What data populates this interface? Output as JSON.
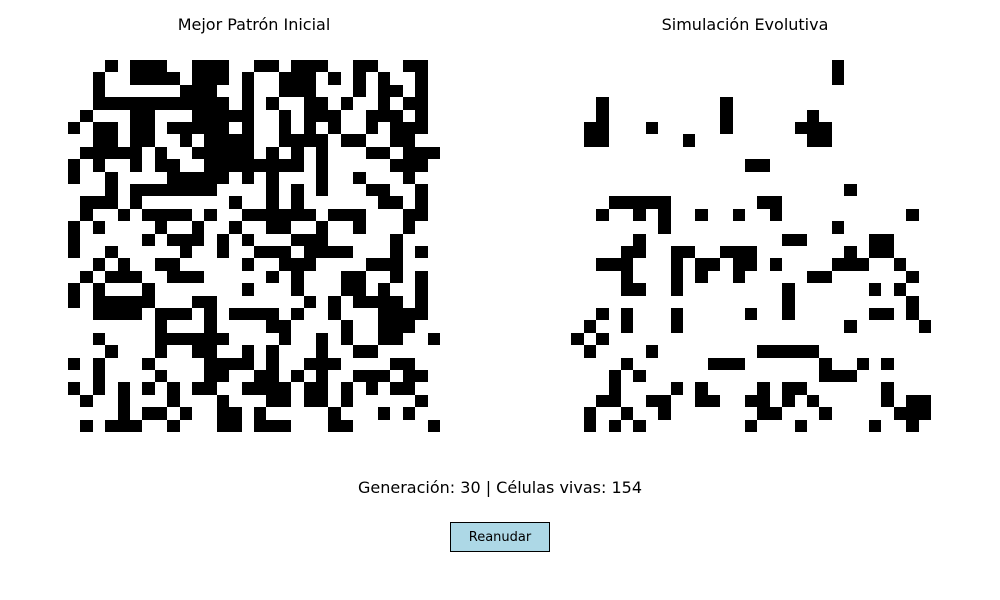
{
  "left_panel": {
    "title": "Mejor Patrón Inicial"
  },
  "right_panel": {
    "title": "Simulación Evolutiva"
  },
  "status": {
    "text": "Generación: 30 | Células vivas: 154",
    "generation": 30,
    "live_cells": 154
  },
  "controls": {
    "resume_label": "Reanudar"
  },
  "colors": {
    "alive": "#000000",
    "dead": "#ffffff",
    "button_bg": "#add8e6"
  },
  "grids": {
    "size": 30,
    "initial": [
      "...x.xxx..xxx..xx.xxx..xx..xx.",
      "..x..xxxx.xxx.x..xxx.x.x.x..x.",
      "..x......xxx..x..xxx...x.xx.x.",
      "..xxxxxxxxxxx.x.x..xx.x..x.xx.",
      ".x...xx...xxxxx..x.xxx..xxx.x.",
      "x.xx.xx.xxxxx.x..x.x.x..x.xxx.",
      "..xx.xx..x.xxxx..xxxx.xx..xx..",
      ".xxxxx.x..xxxxx.x.x.x...xx.xxx",
      "x.x..x.xx..xxxxxxxx.x.....xxx.",
      "x..x....xxxxx.x.x...x..x...x..",
      "...x.xxxxxxx....x.x.x...xx..x.",
      ".xxx.x.......x..x.x......xx.x.",
      ".x..x.xxxx.x..xxxxxx.xxx...xx.",
      "x.x....x..x..x..xx..x..x...x..",
      "x.....x.xxx.x.x...xxx.....x...",
      "x..x.....x..x..xxx.xxxx...x.x.",
      "..x.x..xx.....x..xxx....xxx...",
      ".x.xxx..xxx.....x.x...xx..x.x.",
      "x.x...x.......x...x...xx.x..x.",
      "x.xxxxx...xx.......x.x.xxxx.x.",
      "..xxxx.xxx.x.xxxx.x..x...xxxx.",
      ".......x...x....xx....x..xxx..",
      "..x....xxxxxx....x..x.x..xx..x",
      "...x...x..xx..x.x...x..xx.....",
      "x.x...x....xxxx.x..xxx....xx..",
      "..x....x...xx..xx.x.x..xxx.xx.",
      "x.x.x.x.x.xx..xxxx.xx.x.x.xx..",
      ".x..x...x...x...xx.xx.x.....x.",
      "....x.xx.x..xx.x.....x...x.x..",
      ".x.xxx..x...xx.xxx...xx......x"
    ],
    "current": [
      "......................x.......",
      "......................x.......",
      "..............................",
      "...x.........x................",
      "...x.........x......x.........",
      "..xx...x.....x.....xxx........",
      "..xx......x.........xx........",
      "..............................",
      "...............xx.............",
      "..............................",
      ".......................x......",
      "....xxxxx.......xx............",
      "...x..x.x..x..x..x..........x.",
      "........x.............x.......",
      "......x...........xx.....xx...",
      ".....xx..xx..xxx.......x.xx...",
      "...xxx...x.xx.xx.x....xxx..x..",
      ".....x...x.x..x.....xx......x.",
      ".....xx..x........x......x.x..",
      "..................x.........x.",
      "...x.x...x.....x..x......xx.x.",
      "..x..x...x.............x.....x",
      ".x.x..........................",
      "..x....x........xxxxx.........",
      ".....x......xxx......x..x.x...",
      "....x.x..............xxx......",
      "....x....x.x....x.xx......x...",
      "...xx..xx..xx..xx.x.x.....x.xx",
      "..x..x..x.......xx...x.....xxx",
      "..x.x.x........x...x.....x..x."
    ]
  }
}
